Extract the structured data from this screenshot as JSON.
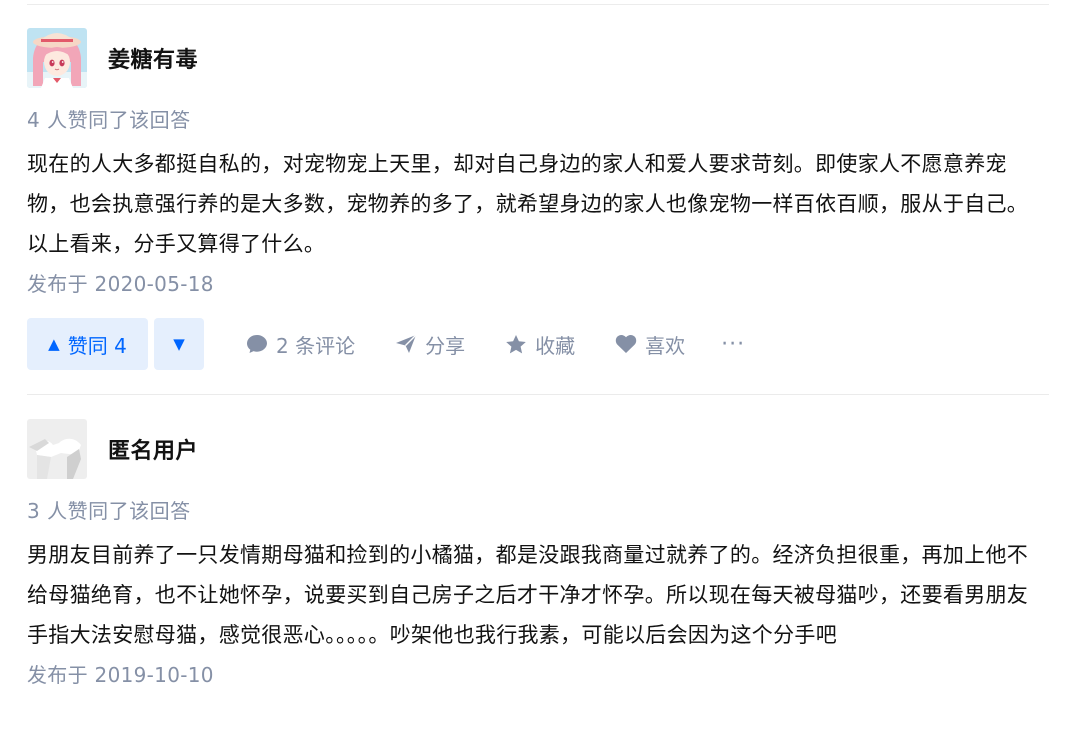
{
  "answers": [
    {
      "author": "姜糖有毒",
      "votes_text": "4 人赞同了该回答",
      "content": "现在的人大多都挺自私的，对宠物宠上天里，却对自己身边的家人和爱人要求苛刻。即使家人不愿意养宠物，也会执意强行养的是大多数，宠物养的多了，就希望身边的家人也像宠物一样百依百顺，服从于自己。以上看来，分手又算得了什么。",
      "published": "发布于 2020-05-18",
      "actions": {
        "upvote_label": "赞同 4",
        "comments_label": "2 条评论",
        "share_label": "分享",
        "collect_label": "收藏",
        "like_label": "喜欢",
        "more_label": "···"
      }
    },
    {
      "author": "匿名用户",
      "votes_text": "3 人赞同了该回答",
      "content": "男朋友目前养了一只发情期母猫和捡到的小橘猫，都是没跟我商量过就养了的。经济负担很重，再加上他不给母猫绝育，也不让她怀孕，说要买到自己房子之后才干净才怀孕。所以现在每天被母猫吵，还要看男朋友手指大法安慰母猫，感觉很恶心。。。。。吵架他也我行我素，可能以后会因为这个分手吧",
      "published": "发布于 2019-10-10"
    }
  ],
  "colors": {
    "accent": "#0066ff",
    "accent_bg": "#e5effd",
    "meta_gray": "#8590a6",
    "text": "#121212"
  },
  "icons": [
    "avatar-anime-girl",
    "triangle-up-icon",
    "triangle-down-icon",
    "comment-bubble-icon",
    "paper-plane-icon",
    "star-icon",
    "heart-icon",
    "ellipsis-icon",
    "anonymous-avatar"
  ]
}
